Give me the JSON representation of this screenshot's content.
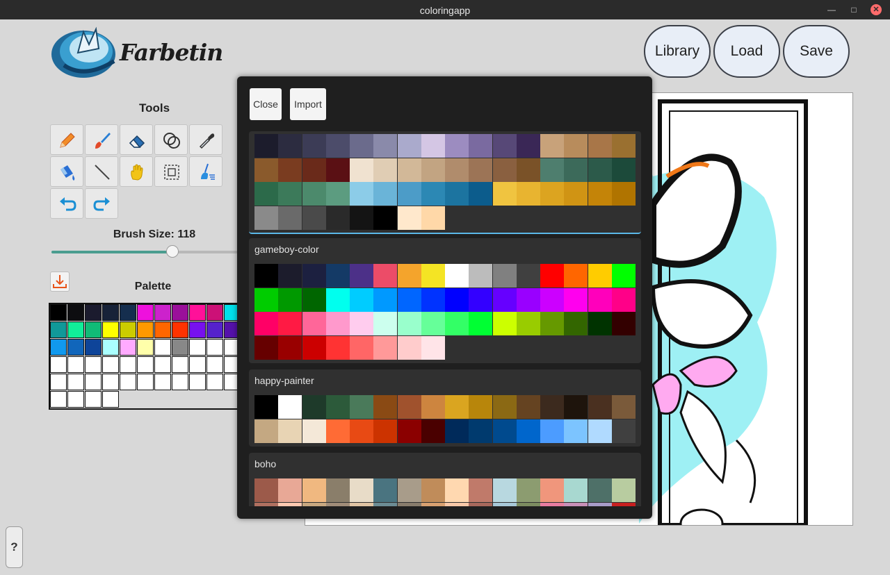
{
  "window": {
    "title": "coloringapp",
    "minimize_icon": "minimize-icon",
    "maximize_icon": "maximize-icon",
    "close_icon": "close-icon"
  },
  "logo": {
    "text": "Farbetin",
    "icon": "fox-logo-icon"
  },
  "top_buttons": [
    {
      "name": "library-button",
      "label": "Library"
    },
    {
      "name": "load-button",
      "label": "Load"
    },
    {
      "name": "save-button",
      "label": "Save"
    }
  ],
  "tools": {
    "heading": "Tools",
    "items": [
      {
        "name": "pencil-tool",
        "icon": "pencil-icon"
      },
      {
        "name": "brush-tool",
        "icon": "brush-icon"
      },
      {
        "name": "eraser-tool",
        "icon": "eraser-icon"
      },
      {
        "name": "blend-tool",
        "icon": "blend-circles-icon"
      },
      {
        "name": "eyedropper-tool",
        "icon": "eyedropper-icon"
      },
      {
        "name": "fill-tool",
        "icon": "paint-bucket-icon"
      },
      {
        "name": "line-tool",
        "icon": "line-icon"
      },
      {
        "name": "pan-tool",
        "icon": "hand-icon"
      },
      {
        "name": "select-tool",
        "icon": "selection-icon"
      },
      {
        "name": "clear-tool",
        "icon": "broom-icon"
      },
      {
        "name": "undo-button",
        "icon": "undo-icon"
      },
      {
        "name": "redo-button",
        "icon": "redo-icon"
      }
    ]
  },
  "brush": {
    "label": "Brush Size: 118",
    "value": 118,
    "fraction": 0.65
  },
  "palette": {
    "heading": "Palette",
    "download_icon": "download-icon",
    "rows": [
      [
        "#000000",
        "#0d0d10",
        "#1b1b2e",
        "#172238",
        "#152e4e",
        "#ee11dd",
        "#cc22cc",
        "#9a0f9a",
        "#ff1199",
        "#cc1177",
        "#00e0ea"
      ],
      [
        "#119999",
        "#11ee99",
        "#11bb77",
        "#ffff00",
        "#cccc00",
        "#ff9900",
        "#ff6600",
        "#ff3300",
        "#7711ee",
        "#5522cc",
        "#5511aa"
      ],
      [
        "#1199ee",
        "#1166bb",
        "#0e4499",
        "#aaffff",
        "#ffaaff",
        "#ffffaa",
        "#ffffff",
        "#888888",
        "#ffffff",
        "#ffffff",
        "#ffffff"
      ],
      [
        "#ffffff",
        "#ffffff",
        "#ffffff",
        "#ffffff",
        "#ffffff",
        "#ffffff",
        "#ffffff",
        "#ffffff",
        "#ffffff",
        "#ffffff",
        "#ffffff"
      ],
      [
        "#ffffff",
        "#ffffff",
        "#ffffff",
        "#ffffff",
        "#ffffff",
        "#ffffff",
        "#ffffff",
        "#ffffff",
        "#ffffff",
        "#ffffff",
        "#ffffff"
      ],
      [
        "#ffffff",
        "#ffffff",
        "#ffffff",
        "#ffffff"
      ]
    ]
  },
  "help": {
    "label": "?"
  },
  "modal": {
    "close_label": "Close",
    "import_label": "Import",
    "palettes": [
      {
        "name": "",
        "colors": [
          "#1c1c2c",
          "#2c2c40",
          "#3c3c56",
          "#4c4c6a",
          "#6b6b8c",
          "#8a8aaa",
          "#aaaacc",
          "#d4c6e4",
          "#9c8cc0",
          "#7a6aa0",
          "#574877",
          "#3a2756",
          "#c8a27a",
          "#b88c5c",
          "#a87648",
          "#9a7030",
          "#8a5a2c",
          "#7a3c20",
          "#6a2a1a",
          "#5a1014",
          "#f0e2d0",
          "#e0cdb4",
          "#d2b898",
          "#c2a482",
          "#b08c6c",
          "#9c7456",
          "#8a6040",
          "#7a5228",
          "#4e7e6e",
          "#3c6a5a",
          "#2c5a4a",
          "#1c4a3a",
          "#2c6a4a",
          "#3c7a5a",
          "#4c8a6c",
          "#5c9c80",
          "#8ccce8",
          "#6ab4d8",
          "#4c9cc8",
          "#2c88b4",
          "#1c74a0",
          "#0c5c8c",
          "#f0c440",
          "#e8b430",
          "#dca420",
          "#d09414",
          "#c48408",
          "#b07400",
          "#8a8a8a",
          "#6a6a6a",
          "#4a4a4a",
          "#2a2a2a",
          "#141414",
          "#000000",
          "#ffe8cc",
          "#ffd8a8"
        ]
      },
      {
        "name": "gameboy-color",
        "colors": [
          "#000000",
          "#1c1c2c",
          "#1c2040",
          "#143a66",
          "#4c3088",
          "#ec4c68",
          "#f4a42c",
          "#f4e424",
          "#ffffff",
          "#bcbcbc",
          "#808080",
          "#404040",
          "#ff0000",
          "#ff6600",
          "#ffcc00",
          "#00ff00",
          "#00cc00",
          "#009900",
          "#006600",
          "#00ffee",
          "#00ccff",
          "#0099ff",
          "#0066ff",
          "#0033ff",
          "#0000ff",
          "#3300ff",
          "#6600ff",
          "#9900ff",
          "#cc00ff",
          "#ff00ee",
          "#ff00bb",
          "#ff0088",
          "#ff0066",
          "#ff1a44",
          "#ff6699",
          "#ff99cc",
          "#ffccee",
          "#ccffee",
          "#99ffcc",
          "#66ff99",
          "#33ff66",
          "#00ff33",
          "#ccff00",
          "#99cc00",
          "#669900",
          "#336600",
          "#003300",
          "#330000",
          "#660000",
          "#990000",
          "#cc0000",
          "#ff3333",
          "#ff6666",
          "#ff9999",
          "#ffcccc",
          "#ffe4e8"
        ]
      },
      {
        "name": "happy-painter",
        "colors": [
          "#000000",
          "#ffffff",
          "#1e3a2a",
          "#2c5a3a",
          "#4a7a5a",
          "#8a4a14",
          "#a0522d",
          "#cd853f",
          "#daa520",
          "#b8860b",
          "#8b6914",
          "#654321",
          "#3c2a1e",
          "#1e140c",
          "#4a3020",
          "#7a5a3a",
          "#c4a882",
          "#e8d4b4",
          "#f4e8d8",
          "#ff6b35",
          "#e84a14",
          "#cc3300",
          "#8b0000",
          "#4a0000",
          "#002a5a",
          "#003a6e",
          "#004a8e",
          "#0066cc",
          "#4c9cff",
          "#7cc4ff",
          "#b0daff",
          "#404040"
        ]
      },
      {
        "name": "boho",
        "colors": [
          "#9c5a4a",
          "#e8a896",
          "#f0b880",
          "#8a7e6a",
          "#e8dcc8",
          "#4a7480",
          "#a89c8a",
          "#c08c5a",
          "#ffd8b0",
          "#c07a6a",
          "#b8d8e0",
          "#8c9c70",
          "#f0967c",
          "#a8d8d0",
          "#4e7068",
          "#b8cca0",
          "#b07060",
          "#ffc8b0",
          "#c8a880",
          "#a08c78",
          "#e0c4a4",
          "#6c8c94",
          "#887c6c",
          "#d8a070",
          "#f8c8a8",
          "#a8685c",
          "#a8c8d8",
          "#7c8c60",
          "#e87ca0",
          "#c890b8",
          "#a89cc8",
          "#c82020"
        ]
      }
    ]
  }
}
